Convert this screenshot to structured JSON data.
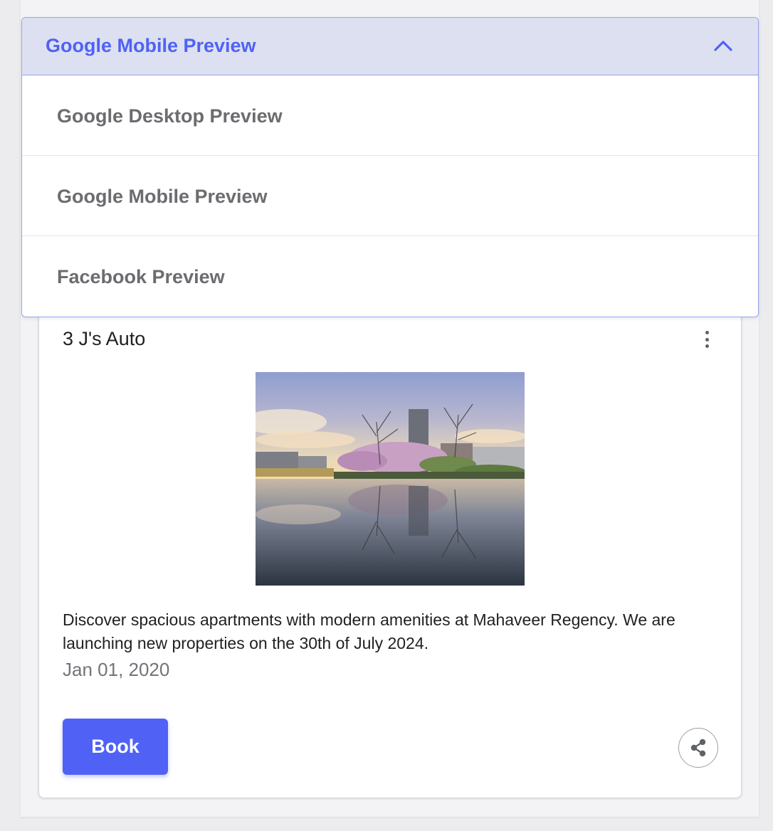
{
  "dropdown": {
    "selected_label": "Google Mobile Preview",
    "chevron_icon": "chevron-up-icon",
    "options": [
      {
        "label": "Google Desktop Preview"
      },
      {
        "label": "Google Mobile Preview"
      },
      {
        "label": "Facebook Preview"
      }
    ]
  },
  "post": {
    "business_name": "3 J's Auto",
    "menu_icon": "more-vertical-icon",
    "image_icon": "landscape-photo-cherry-blossom-river",
    "description": "Discover spacious apartments with modern amenities at Mahaveer Regency. We are launching new properties on the 30th of July 2024.",
    "date": "Jan 01, 2020",
    "cta_label": "Book",
    "share_icon": "share-icon"
  },
  "colors": {
    "accent": "#4f62f5",
    "dropdown_header_bg": "#dde0f1",
    "dropdown_border": "#97a3ef",
    "option_text": "#6c6c70",
    "date_text": "#70757a"
  }
}
